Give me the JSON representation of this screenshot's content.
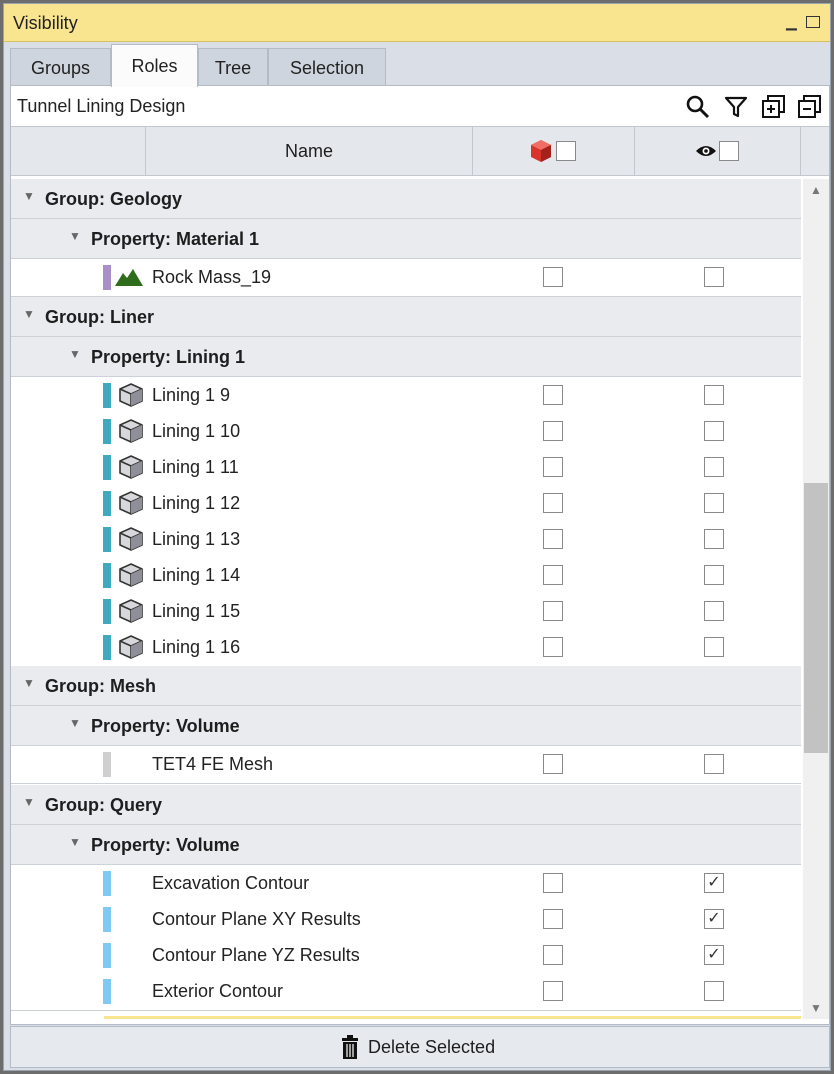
{
  "window": {
    "title": "Visibility"
  },
  "tabs": [
    {
      "label": "Groups",
      "active": false
    },
    {
      "label": "Roles",
      "active": true
    },
    {
      "label": "Tree",
      "active": false
    },
    {
      "label": "Selection",
      "active": false
    }
  ],
  "toolbar": {
    "design_title": "Tunnel Lining Design",
    "icons": [
      "search-icon",
      "filter-icon",
      "expand-all-icon",
      "collapse-all-icon"
    ]
  },
  "header": {
    "name_label": "Name",
    "col1_icon": "red-cube-icon",
    "col2_icon": "eye-icon"
  },
  "groups": [
    {
      "label": "Group: Geology",
      "property": "Property: Material 1",
      "items": [
        {
          "name": "Rock Mass_19",
          "color": "#a98fc8",
          "icon": "terrain-icon",
          "c1": false,
          "c2": false
        }
      ]
    },
    {
      "label": "Group: Liner",
      "property": "Property: Lining 1",
      "items": [
        {
          "name": "Lining 1 9",
          "color": "#3fa9c0",
          "icon": "cube-icon",
          "c1": false,
          "c2": false
        },
        {
          "name": "Lining 1 10",
          "color": "#3fa9c0",
          "icon": "cube-icon",
          "c1": false,
          "c2": false
        },
        {
          "name": "Lining 1 11",
          "color": "#3fa9c0",
          "icon": "cube-icon",
          "c1": false,
          "c2": false
        },
        {
          "name": "Lining 1 12",
          "color": "#3fa9c0",
          "icon": "cube-icon",
          "c1": false,
          "c2": false
        },
        {
          "name": "Lining 1 13",
          "color": "#3fa9c0",
          "icon": "cube-icon",
          "c1": false,
          "c2": false
        },
        {
          "name": "Lining 1 14",
          "color": "#3fa9c0",
          "icon": "cube-icon",
          "c1": false,
          "c2": false
        },
        {
          "name": "Lining 1 15",
          "color": "#3fa9c0",
          "icon": "cube-icon",
          "c1": false,
          "c2": false
        },
        {
          "name": "Lining 1 16",
          "color": "#3fa9c0",
          "icon": "cube-icon",
          "c1": false,
          "c2": false
        }
      ]
    },
    {
      "label": "Group: Mesh",
      "property": "Property: Volume",
      "items": [
        {
          "name": "TET4 FE Mesh",
          "color": "#cfcfcf",
          "icon": "",
          "c1": false,
          "c2": false
        }
      ]
    },
    {
      "label": "Group: Query",
      "property": "Property: Volume",
      "items": [
        {
          "name": "Excavation Contour",
          "color": "#7fc9f2",
          "icon": "",
          "c1": false,
          "c2": true
        },
        {
          "name": "Contour Plane XY Results",
          "color": "#7fc9f2",
          "icon": "",
          "c1": false,
          "c2": true
        },
        {
          "name": "Contour Plane YZ Results",
          "color": "#7fc9f2",
          "icon": "",
          "c1": false,
          "c2": true
        },
        {
          "name": "Exterior Contour",
          "color": "#7fc9f2",
          "icon": "",
          "c1": false,
          "c2": false
        }
      ]
    }
  ],
  "footer": {
    "delete_label": "Delete Selected",
    "delete_icon": "trash-icon"
  },
  "check_mark": "✓"
}
